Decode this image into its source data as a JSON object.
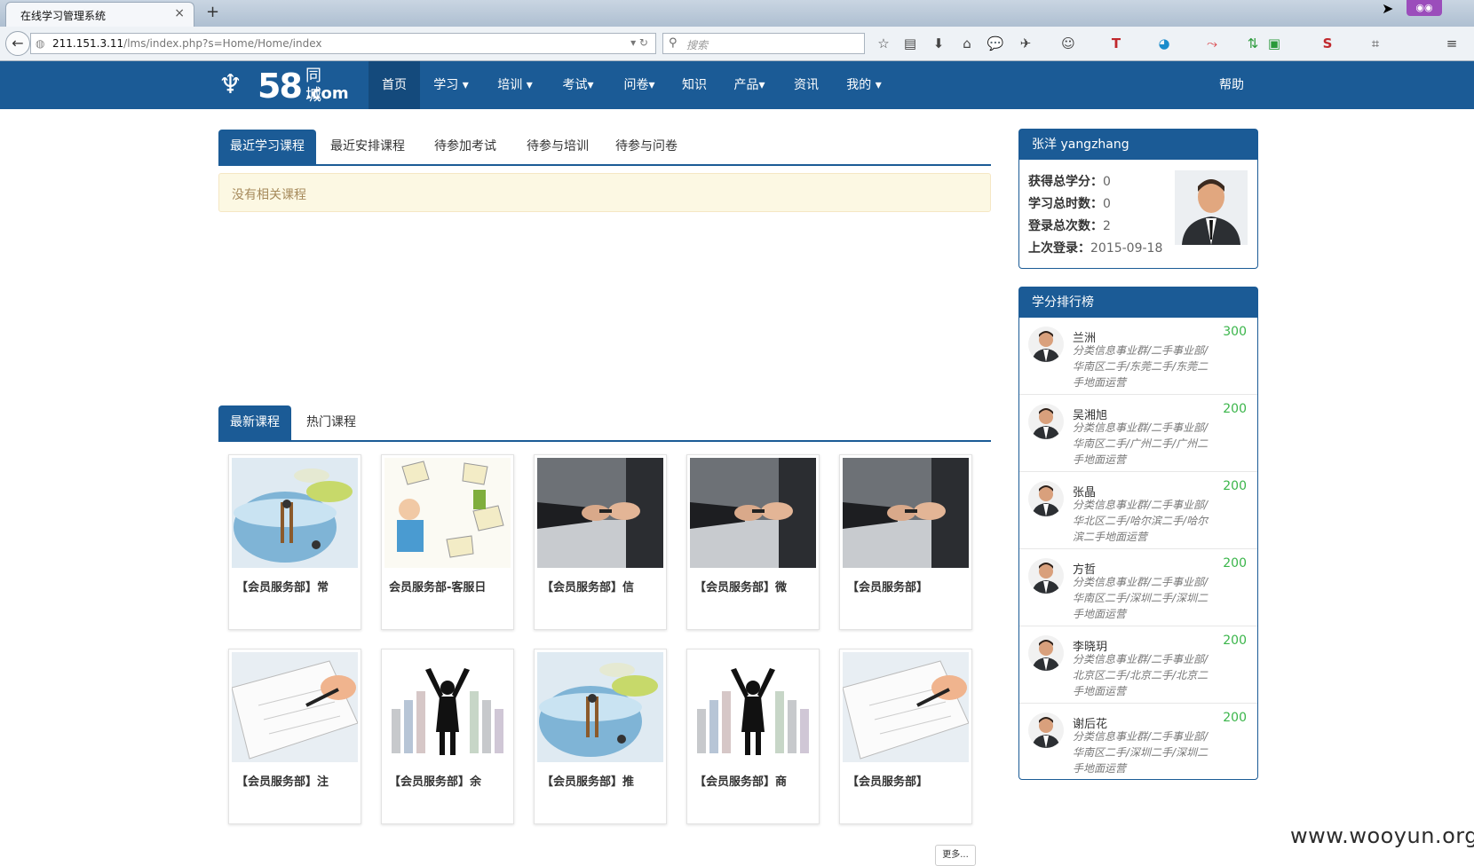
{
  "browser": {
    "tab_title": "在线学习管理系统",
    "tab_close": "×",
    "new_tab": "+",
    "url_host": "211.151.3.11",
    "url_path": "/lms/index.php?s=Home/Home/index",
    "search_placeholder": "搜索"
  },
  "nav": {
    "logo_num": "58",
    "logo_cn": "同城",
    "logo_com": ".com",
    "items": [
      "首页",
      "学习 ▾",
      "培训 ▾",
      "考试▾",
      "问卷▾",
      "知识",
      "产品▾",
      "资讯",
      "我的 ▾"
    ],
    "help": "帮助"
  },
  "course_tabs": [
    "最近学习课程",
    "最近安排课程",
    "待参加考试",
    "待参与培训",
    "待参与问卷"
  ],
  "empty_message": "没有相关课程",
  "catalog_tabs": [
    "最新课程",
    "热门课程"
  ],
  "courses": [
    {
      "title": "【会员服务部】常",
      "image": "bowls-illustration"
    },
    {
      "title": "会员服务部-客服日",
      "image": "mail-illustration"
    },
    {
      "title": "【会员服务部】信",
      "image": "car-key-handover"
    },
    {
      "title": "【会员服务部】微",
      "image": "car-key-handover"
    },
    {
      "title": "【会员服务部】",
      "image": "car-key-handover"
    },
    {
      "title": "【会员服务部】注",
      "image": "hand-writing"
    },
    {
      "title": "【会员服务部】余",
      "image": "success-silhouette"
    },
    {
      "title": "【会员服务部】推",
      "image": "bowls-illustration"
    },
    {
      "title": "【会员服务部】商",
      "image": "success-silhouette"
    },
    {
      "title": "【会员服务部】",
      "image": "hand-writing"
    }
  ],
  "more_label": "更多...",
  "profile": {
    "name": "张洋 yangzhang",
    "stats": [
      {
        "label": "获得总学分：",
        "value": "0"
      },
      {
        "label": "学习总时数：",
        "value": "0"
      },
      {
        "label": "登录总次数：",
        "value": "2"
      },
      {
        "label": "上次登录：",
        "value": "2015-09-18"
      }
    ]
  },
  "ranking": {
    "title": "学分排行榜",
    "rows": [
      {
        "name": "兰洲",
        "dept": "分类信息事业群/二手事业部/华南区二手/东莞二手/东莞二手地面运营",
        "score": "300"
      },
      {
        "name": "吴湘旭",
        "dept": "分类信息事业群/二手事业部/华南区二手/广州二手/广州二手地面运营",
        "score": "200"
      },
      {
        "name": "张晶",
        "dept": "分类信息事业群/二手事业部/华北区二手/哈尔滨二手/哈尔滨二手地面运营",
        "score": "200"
      },
      {
        "name": "方哲",
        "dept": "分类信息事业群/二手事业部/华南区二手/深圳二手/深圳二手地面运营",
        "score": "200"
      },
      {
        "name": "李晓玥",
        "dept": "分类信息事业群/二手事业部/北京区二手/北京二手/北京二手地面运营",
        "score": "200"
      },
      {
        "name": "谢后花",
        "dept": "分类信息事业群/二手事业部/华南区二手/深圳二手/深圳二手地面运营",
        "score": "200"
      }
    ]
  },
  "watermark": "www.wooyun.org",
  "colors": {
    "brand": "#1b5b96",
    "score": "#3ab54a",
    "alert_bg": "#fcf8e3"
  }
}
